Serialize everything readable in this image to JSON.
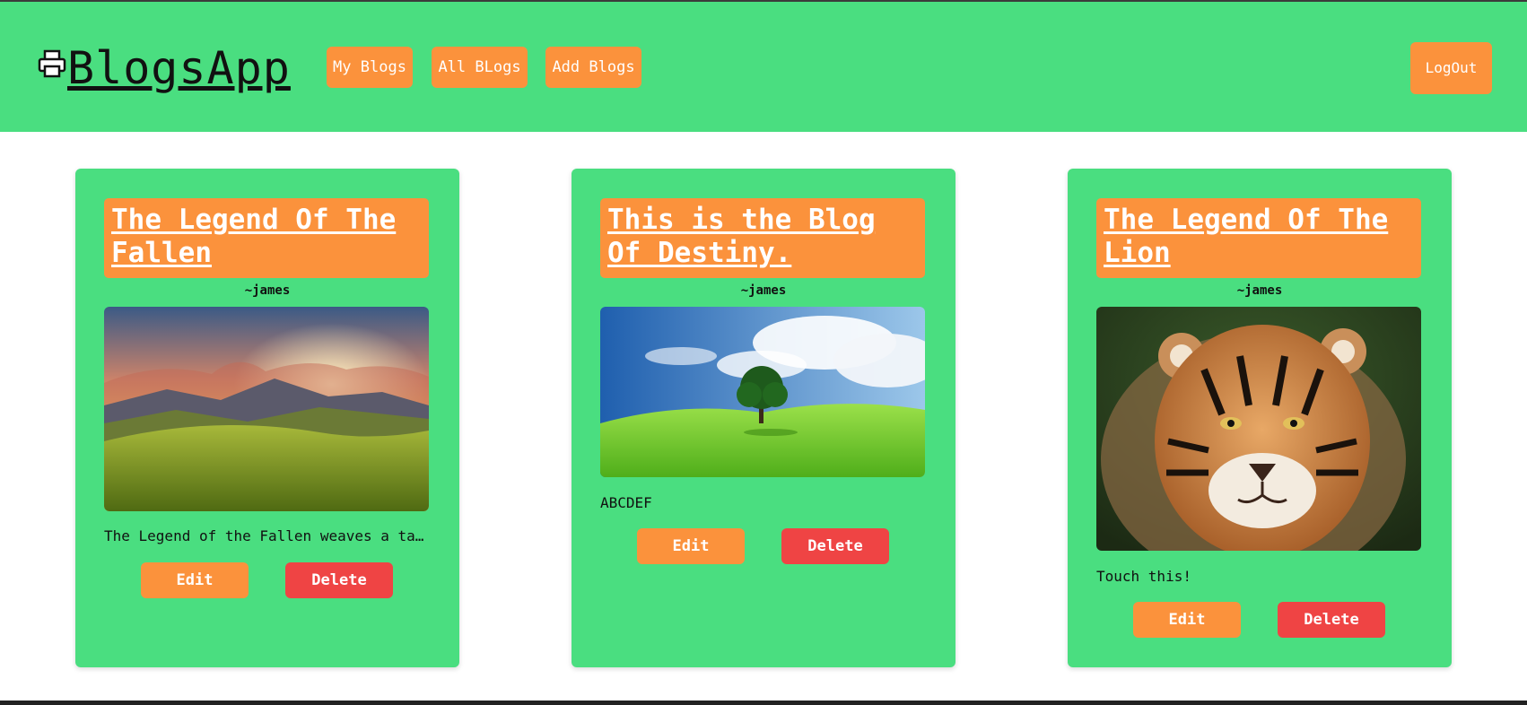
{
  "brand": {
    "name": "BlogsApp",
    "icon": "printer-icon"
  },
  "nav": {
    "my_blogs": "My Blogs",
    "all_blogs": "All BLogs",
    "add_blogs": "Add Blogs",
    "logout": "LogOut"
  },
  "colors": {
    "accent": "#4ade80",
    "primary_button": "#fb923c",
    "danger_button": "#ef4444"
  },
  "blogs": [
    {
      "title": "The Legend Of The Fallen",
      "author": "~james",
      "image": "mountain-sunset-image",
      "description": "The Legend of the Fallen weaves a ta…",
      "edit_label": "Edit",
      "delete_label": "Delete"
    },
    {
      "title": "This is the Blog Of Destiny.",
      "author": "~james",
      "image": "green-field-tree-image",
      "description": "ABCDEF",
      "edit_label": "Edit",
      "delete_label": "Delete"
    },
    {
      "title": "The Legend Of The Lion",
      "author": "~james",
      "image": "tiger-image",
      "description": "Touch this!",
      "edit_label": "Edit",
      "delete_label": "Delete"
    }
  ]
}
